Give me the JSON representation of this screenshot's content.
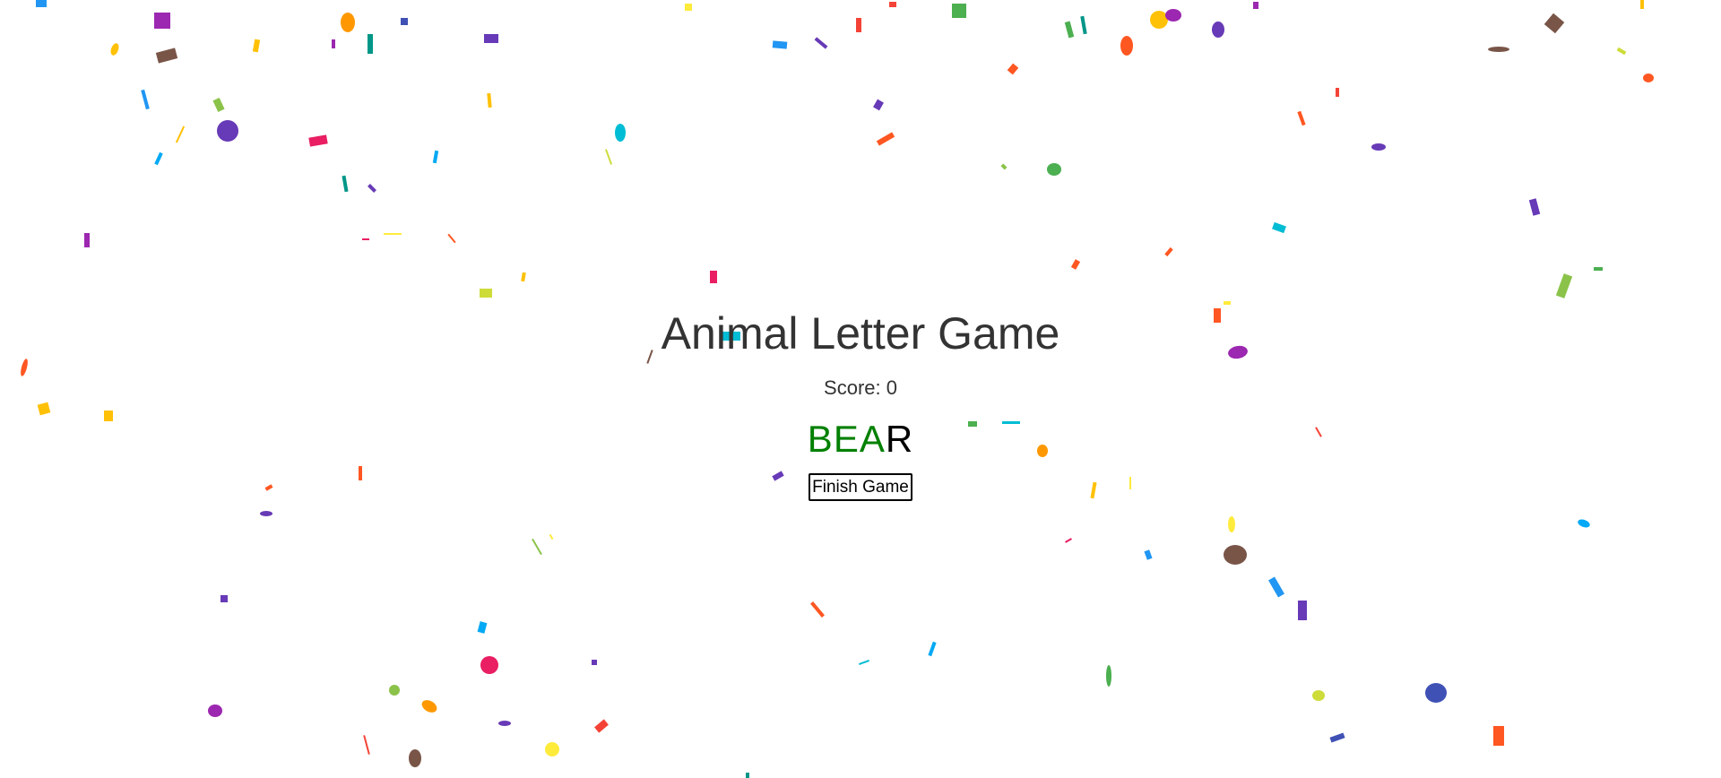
{
  "game": {
    "title": "Animal Letter Game",
    "score_text": "Score: 0",
    "word": {
      "letters": [
        {
          "char": "B",
          "state": "correct"
        },
        {
          "char": "E",
          "state": "correct"
        },
        {
          "char": "A",
          "state": "correct"
        },
        {
          "char": "R",
          "state": "pending"
        }
      ]
    },
    "finish_button_label": "Finish Game"
  },
  "colors": {
    "correct_letter": "#008000",
    "pending_letter": "#000000",
    "title_text": "#333333",
    "confetti_palette": [
      "#9c27b0",
      "#673ab7",
      "#3f51b5",
      "#2196f3",
      "#03a9f4",
      "#00bcd4",
      "#009688",
      "#4caf50",
      "#8bc34a",
      "#cddc39",
      "#ffeb3b",
      "#ffc107",
      "#ff9800",
      "#ff5722",
      "#f44336",
      "#e91e63",
      "#795548"
    ]
  }
}
